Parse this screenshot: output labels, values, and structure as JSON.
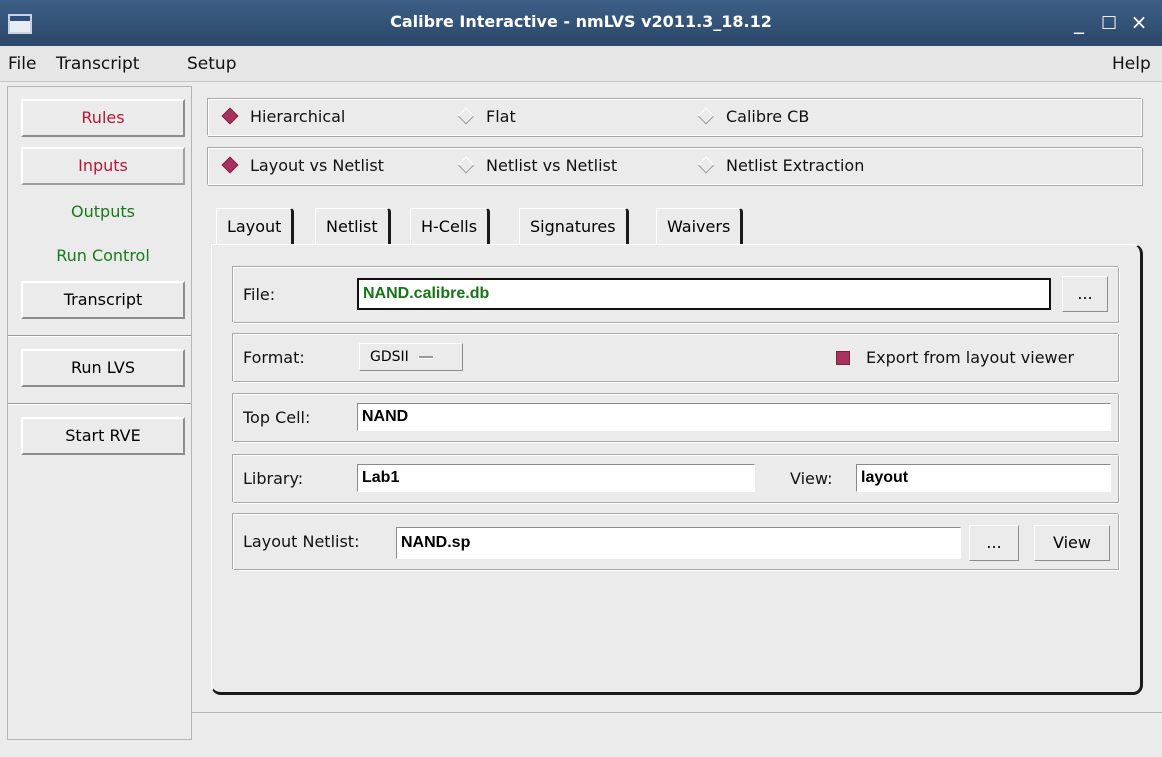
{
  "window": {
    "title": "Calibre Interactive - nmLVS v2011.3_18.12",
    "minimize": "_",
    "maximize": "□",
    "close": "×"
  },
  "menu": {
    "file": "File",
    "transcript": "Transcript",
    "setup": "Setup",
    "help": "Help"
  },
  "sidebar": {
    "rules": "Rules",
    "inputs": "Inputs",
    "outputs": "Outputs",
    "run_control": "Run Control",
    "transcript": "Transcript",
    "run_lvs": "Run LVS",
    "start_rve": "Start RVE"
  },
  "mode": {
    "hierarchical": "Hierarchical",
    "flat": "Flat",
    "calibre_cb": "Calibre CB",
    "selected": "hierarchical"
  },
  "comparison": {
    "layout_vs_netlist": "Layout vs Netlist",
    "netlist_vs_netlist": "Netlist vs Netlist",
    "netlist_extraction": "Netlist Extraction",
    "selected": "layout_vs_netlist"
  },
  "tabs": [
    "Layout",
    "Netlist",
    "H-Cells",
    "Signatures",
    "Waivers"
  ],
  "active_tab": "Layout",
  "layout": {
    "file_label": "File:",
    "file_value": "NAND.calibre.db",
    "browse": "...",
    "format_label": "Format:",
    "format_value": "GDSII",
    "export_label": "Export from layout viewer",
    "export_checked": true,
    "top_cell_label": "Top Cell:",
    "top_cell_value": "NAND",
    "library_label": "Library:",
    "library_value": "Lab1",
    "view_label": "View:",
    "view_value": "layout",
    "netlist_label": "Layout Netlist:",
    "netlist_value": "NAND.sp",
    "netlist_browse": "...",
    "netlist_view": "View"
  },
  "colors": {
    "accent_red": "#b3193a",
    "accent_green": "#187a18",
    "selection": "#a8325f"
  }
}
